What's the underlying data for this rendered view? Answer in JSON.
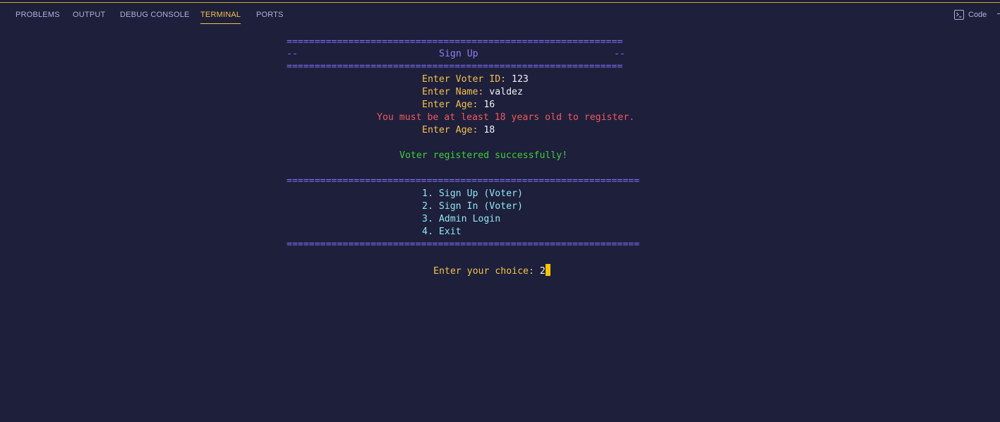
{
  "panel": {
    "tabs": [
      {
        "label": "PROBLEMS"
      },
      {
        "label": "OUTPUT"
      },
      {
        "label": "DEBUG CONSOLE"
      },
      {
        "label": "TERMINAL"
      },
      {
        "label": "PORTS"
      }
    ],
    "active_tab": "TERMINAL",
    "terminal_profile": {
      "label": "Code",
      "icon": "terminal-icon"
    }
  },
  "terminal": {
    "signup": {
      "rule": "============================================================",
      "title_left": "--",
      "title": "Sign Up",
      "title_right": "--",
      "voter_id_prompt": "Enter Voter ID:",
      "voter_id_value": "123",
      "name_prompt": "Enter Name:",
      "name_value": "valdez",
      "age_prompt": "Enter Age:",
      "age_value_1": "16",
      "age_error": "You must be at least 18 years old to register.",
      "age_value_2": "18",
      "success": "Voter registered successfully!"
    },
    "menu": {
      "rule": "===============================================================",
      "items": [
        "1. Sign Up (Voter)",
        "2. Sign In (Voter)",
        "3. Admin Login",
        "4. Exit"
      ],
      "choice_prompt": "Enter your choice:",
      "choice_value": "2"
    }
  },
  "colors": {
    "background": "#1e1f3b",
    "accent": "#f2c14e",
    "rule": "#7f6ff2",
    "error": "#f0595d",
    "success": "#3fcf3a",
    "menu": "#8ee8f0"
  }
}
